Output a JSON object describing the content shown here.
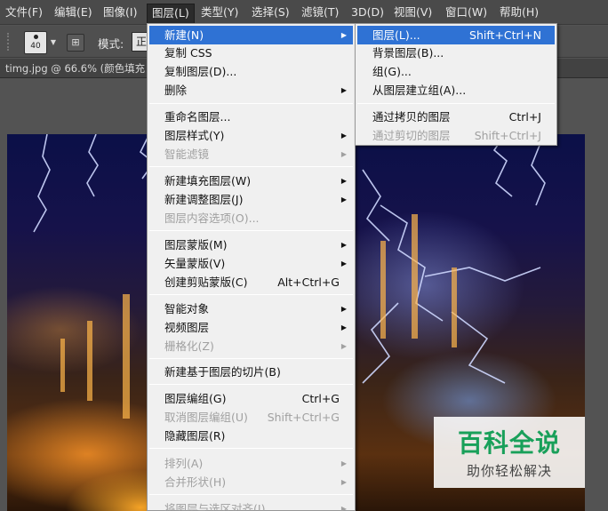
{
  "menubar": {
    "items": [
      "文件(F)",
      "编辑(E)",
      "图像(I)",
      "图层(L)",
      "类型(Y)",
      "选择(S)",
      "滤镜(T)",
      "3D(D)",
      "视图(V)",
      "窗口(W)",
      "帮助(H)"
    ]
  },
  "options": {
    "brush_size": "40",
    "mode_label": "模式:",
    "mode_value": "正常"
  },
  "document": {
    "tab_label": "timg.jpg @ 66.6% (颜色填充"
  },
  "layer_menu": {
    "items": [
      {
        "label": "新建(N)",
        "shortcut": "",
        "submenu": true,
        "disabled": false
      },
      {
        "label": "复制 CSS",
        "shortcut": "",
        "submenu": false,
        "disabled": false
      },
      {
        "label": "复制图层(D)...",
        "shortcut": "",
        "submenu": false,
        "disabled": false
      },
      {
        "label": "删除",
        "shortcut": "",
        "submenu": true,
        "disabled": false
      },
      {
        "label": "重命名图层...",
        "shortcut": "",
        "submenu": false,
        "disabled": false
      },
      {
        "label": "图层样式(Y)",
        "shortcut": "",
        "submenu": true,
        "disabled": false
      },
      {
        "label": "智能滤镜",
        "shortcut": "",
        "submenu": true,
        "disabled": true
      },
      {
        "label": "新建填充图层(W)",
        "shortcut": "",
        "submenu": true,
        "disabled": false
      },
      {
        "label": "新建调整图层(J)",
        "shortcut": "",
        "submenu": true,
        "disabled": false
      },
      {
        "label": "图层内容选项(O)...",
        "shortcut": "",
        "submenu": false,
        "disabled": true
      },
      {
        "label": "图层蒙版(M)",
        "shortcut": "",
        "submenu": true,
        "disabled": false
      },
      {
        "label": "矢量蒙版(V)",
        "shortcut": "",
        "submenu": true,
        "disabled": false
      },
      {
        "label": "创建剪贴蒙版(C)",
        "shortcut": "Alt+Ctrl+G",
        "submenu": false,
        "disabled": false
      },
      {
        "label": "智能对象",
        "shortcut": "",
        "submenu": true,
        "disabled": false
      },
      {
        "label": "视频图层",
        "shortcut": "",
        "submenu": true,
        "disabled": false
      },
      {
        "label": "栅格化(Z)",
        "shortcut": "",
        "submenu": true,
        "disabled": true
      },
      {
        "label": "新建基于图层的切片(B)",
        "shortcut": "",
        "submenu": false,
        "disabled": false
      },
      {
        "label": "图层编组(G)",
        "shortcut": "Ctrl+G",
        "submenu": false,
        "disabled": false
      },
      {
        "label": "取消图层编组(U)",
        "shortcut": "Shift+Ctrl+G",
        "submenu": false,
        "disabled": true
      },
      {
        "label": "隐藏图层(R)",
        "shortcut": "",
        "submenu": false,
        "disabled": false
      },
      {
        "label": "排列(A)",
        "shortcut": "",
        "submenu": true,
        "disabled": true
      },
      {
        "label": "合并形状(H)",
        "shortcut": "",
        "submenu": true,
        "disabled": true
      },
      {
        "label": "将图层与选区对齐(I)",
        "shortcut": "",
        "submenu": true,
        "disabled": true
      }
    ]
  },
  "new_submenu": {
    "items": [
      {
        "label": "图层(L)...",
        "shortcut": "Shift+Ctrl+N",
        "disabled": false
      },
      {
        "label": "背景图层(B)...",
        "shortcut": "",
        "disabled": false
      },
      {
        "label": "组(G)...",
        "shortcut": "",
        "disabled": false
      },
      {
        "label": "从图层建立组(A)...",
        "shortcut": "",
        "disabled": false
      },
      {
        "label": "通过拷贝的图层",
        "shortcut": "Ctrl+J",
        "disabled": false
      },
      {
        "label": "通过剪切的图层",
        "shortcut": "Shift+Ctrl+J",
        "disabled": true
      }
    ]
  },
  "watermark": {
    "title": "百科全说",
    "subtitle": "助你轻松解决"
  },
  "colors": {
    "menu_highlight": "#2f72d4",
    "watermark_green": "#19a05a"
  }
}
